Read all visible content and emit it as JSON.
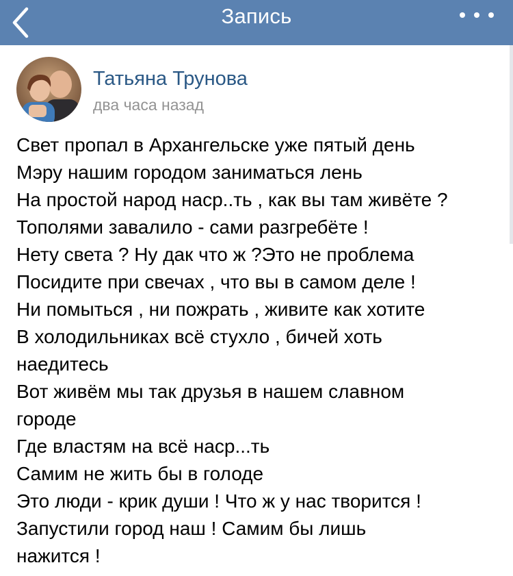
{
  "navbar": {
    "title": "Запись",
    "back_icon": "chevron-left-icon",
    "more_icon": "ellipsis-icon",
    "background": "#5b82b1"
  },
  "post": {
    "author": "Татьяна Трунова",
    "time": "два часа назад",
    "lines": [
      "Свет пропал в Архангельске уже пятый день",
      "Мэру нашим городом заниматься лень",
      "На простой народ наср..ть , как вы там живёте ?",
      "Тополями завалило - сами разгребёте !",
      "Нету света ? Ну дак что ж ?Это не проблема",
      "Посидите при свечах , что вы в самом деле !",
      "Ни помыться , ни пожрать , живите как хотите",
      "В холодильниках всё стухло , бичей хоть",
      "наедитесь",
      "Вот живём мы так друзья в нашем славном",
      "городе",
      "Где властям на всё наср...ть",
      "Самим не жить бы в голоде",
      "Это люди - крик души ! Что ж у нас творится !",
      "Запустили город наш ! Самим бы лишь",
      "нажится !"
    ]
  },
  "colors": {
    "author_link": "#2a5885",
    "time_gray": "#939393"
  }
}
